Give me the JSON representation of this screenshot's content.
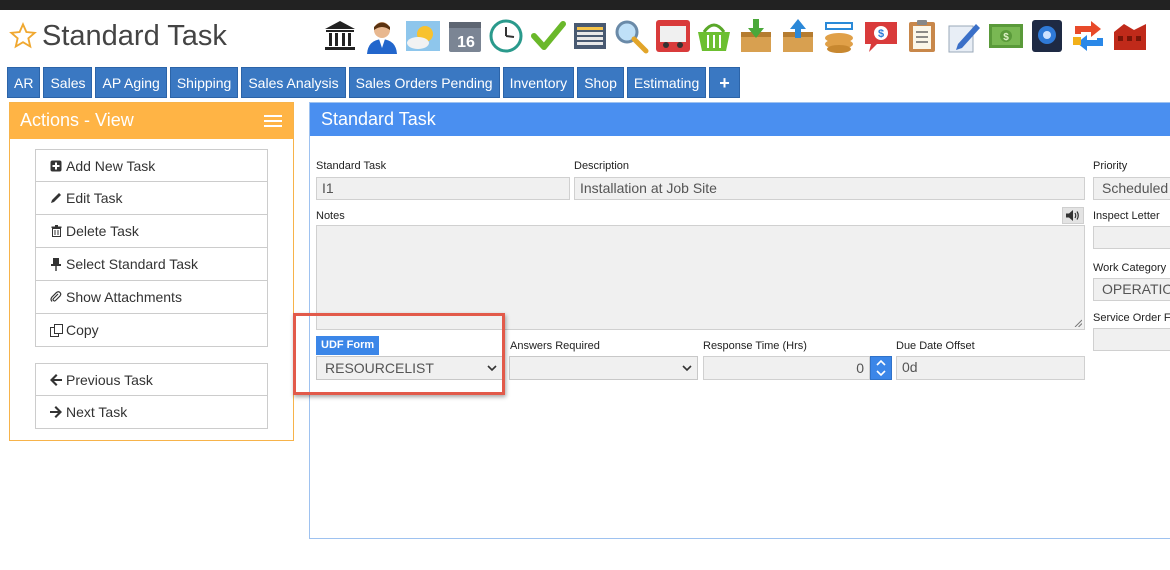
{
  "page": {
    "title": "Standard Task",
    "star_icon": "star-outline-icon"
  },
  "toolbar_icons": [
    "bank-icon",
    "customer-icon",
    "weather-icon",
    "calendar-16-icon",
    "clock-icon",
    "checkmark-icon",
    "spreadsheet-icon",
    "magnifier-icon",
    "truck-icon",
    "basket-icon",
    "receive-inbox-icon",
    "ship-outbox-icon",
    "cash-register-icon",
    "price-bubble-icon",
    "clipboard-icon",
    "pencil-edit-icon",
    "money-icon",
    "safe-icon",
    "transfer-arrows-icon",
    "warehouse-icon"
  ],
  "tabs": [
    "AR",
    "Sales",
    "AP Aging",
    "Shipping",
    "Sales Analysis",
    "Sales Orders Pending",
    "Inventory",
    "Shop",
    "Estimating",
    "+"
  ],
  "actions": {
    "title": "Actions - View",
    "group1": [
      {
        "label": "Add New Task",
        "icon": "plus-square-icon"
      },
      {
        "label": "Edit Task",
        "icon": "pencil-icon"
      },
      {
        "label": "Delete Task",
        "icon": "trash-icon"
      },
      {
        "label": "Select Standard Task",
        "icon": "pushpin-icon"
      },
      {
        "label": "Show Attachments",
        "icon": "paperclip-icon"
      },
      {
        "label": "Copy",
        "icon": "copy-icon"
      }
    ],
    "group2": [
      {
        "label": "Previous Task",
        "icon": "arrow-left-icon"
      },
      {
        "label": "Next Task",
        "icon": "arrow-right-icon"
      }
    ]
  },
  "form": {
    "header": "Standard Task",
    "standard_task_label": "Standard Task",
    "standard_task_value": "I1",
    "description_label": "Description",
    "description_value": "Installation at Job Site",
    "priority_label": "Priority",
    "priority_value": "Scheduled",
    "notes_label": "Notes",
    "notes_value": "",
    "inspect_letter_label": "Inspect Letter",
    "inspect_letter_value": "",
    "work_category_label": "Work Category",
    "work_category_value": "OPERATIO",
    "service_order_label": "Service Order F",
    "service_order_value": "",
    "udf_form_label": "UDF Form",
    "udf_form_value": "RESOURCELIST",
    "answers_required_label": "Answers Required",
    "answers_required_value": "",
    "response_time_label": "Response Time (Hrs)",
    "response_time_value": "0",
    "due_date_offset_label": "Due Date Offset",
    "due_date_offset_value": "0d"
  },
  "colors": {
    "tab_blue": "#3a78c2",
    "actions_orange": "#ffb445",
    "main_header_blue": "#4a8ff0",
    "highlight_red": "#e25a4a",
    "udf_badge_blue": "#3b86e8"
  }
}
